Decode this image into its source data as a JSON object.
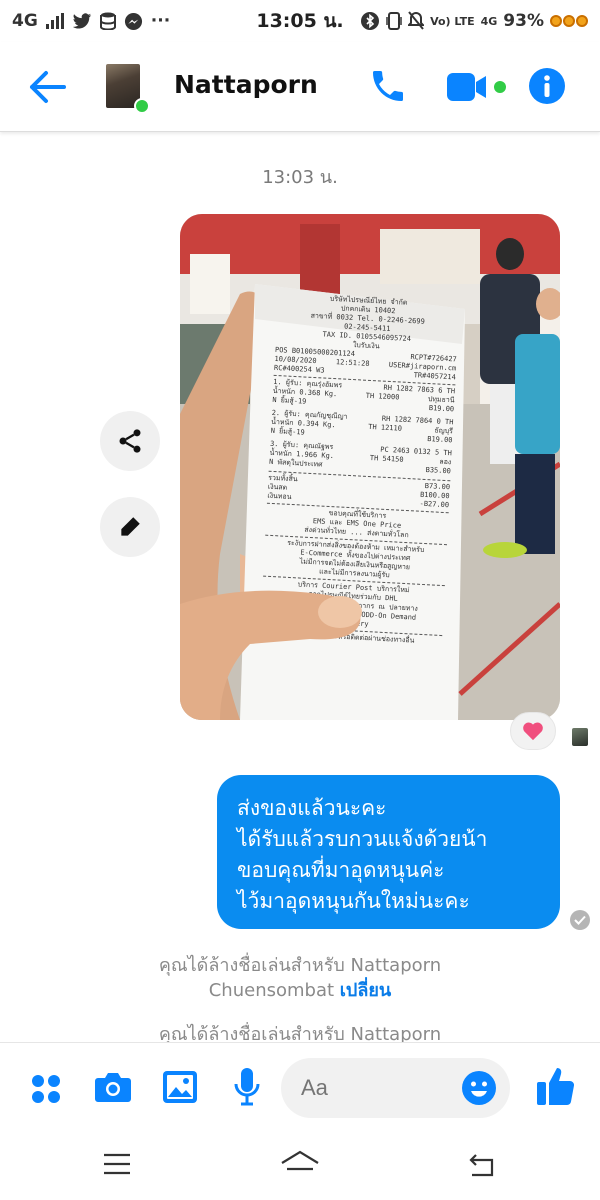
{
  "status_bar": {
    "network": "4G",
    "time": "13:05 น.",
    "battery": "93%",
    "volte": "Vo) LTE",
    "net2": "4G"
  },
  "header": {
    "contact_name": "Nattaporn"
  },
  "chat": {
    "timestamp": "13:03 น.",
    "message_lines": [
      "ส่งของแล้วนะคะ",
      "ได้รับแล้วรบกวนแจ้งด้วยน้า",
      "ขอบคุณที่มาอุดหนุนค่ะ",
      "ไว้มาอุดหนุนกันใหม่นะคะ"
    ],
    "system_message_1": {
      "line1": "คุณได้ล้างชื่อเล่นสำหรับ Nattaporn",
      "line2": "Chuensombat",
      "link": "เปลี่ยน"
    },
    "system_message_2": {
      "line1": "คุณได้ล้างชื่อเล่นสำหรับ Nattaporn"
    }
  },
  "composer": {
    "placeholder": "Aa"
  },
  "receipt": {
    "company": "บริษัทไปรษณีย์ไทย จำกัด",
    "postcode": "ปกคกเดิน 10402",
    "branch": "สาขาที่ 0032 Tel. 0-2246-2699",
    "tel2": "02-245-5411",
    "tax": "TAX ID. 0105546095724",
    "doc": "ใบรับเงิน",
    "pos": "POS B01005000201124",
    "rcpt": "RCPT#726427",
    "date": "10/08/2020",
    "clock": "12:51:28",
    "user": "USER#jiraporn.cm",
    "rc": "RC#400254 W3",
    "tr": "TR#4057214",
    "items": [
      {
        "head": "1. ผู้รับ: คุณรุ่งอัมพร",
        "track": "RH 1282 7863 6 TH",
        "weight": "น้ำหนัก 0.368 Kg.",
        "zip": "TH 12000",
        "place": "ปทุมธานี",
        "svc": "N ยิ้มสู้-19",
        "price": "B19.00"
      },
      {
        "head": "2. ผู้รับ: คุณกัญชุณีญา",
        "track": "RH 1282 7864 0 TH",
        "weight": "น้ำหนัก 0.394 Kg.",
        "zip": "TH 12110",
        "place": "ธัญบุรี",
        "svc": "N ยิ้มสู้-19",
        "price": "B19.00"
      },
      {
        "head": "3. ผู้รับ: คุณณัฐพร",
        "track": "PC 2463 0132 5 TH",
        "weight": "น้ำหนัก 1.966 Kg.",
        "zip": "TH 54150",
        "place": "ลอง",
        "svc": "N พัสดุในประเทศ",
        "price": "B35.00"
      }
    ],
    "total_label": "รวมทั้งสิ้น",
    "total": "B73.00",
    "cash_label": "เงินสด",
    "cash": "B100.00",
    "change_label": "เงินทอน",
    "change": "-B27.00",
    "thanks": "ขอบคุณที่ใช้บริการ",
    "ems": "EMS และ EMS One Price",
    "world": "ส่งด่วนทั่วไทย ... ส่งตามทั่วโลก",
    "note1": "ระงับการฝากส่งสิ่งของต้องห้าม เหมาะสำหรับ",
    "note2": "E-Commerce ทั้งของไปต่างประเทศ",
    "note3": "ไม่มีการจดไม่ต้องเสียเงินหรือสูญหาย",
    "note4": "และไม่มีการลงนามผู้รับ",
    "courier1": "บริการ Courier Post บริการใหม่",
    "courier2": "จากไปรษณีย์ไทยร่วมกับ DHL",
    "courier3": "ให้บริการผ่านพิธีการศุลกากร ณ ปลายทาง",
    "courier4": "พร้อมตัวเลือกการชำระ ODD-On Demand",
    "courier5": "Delivery",
    "footer": "ตรวจสอบสถานะหรือติดต่อผ่านช่องทางอื่น"
  }
}
